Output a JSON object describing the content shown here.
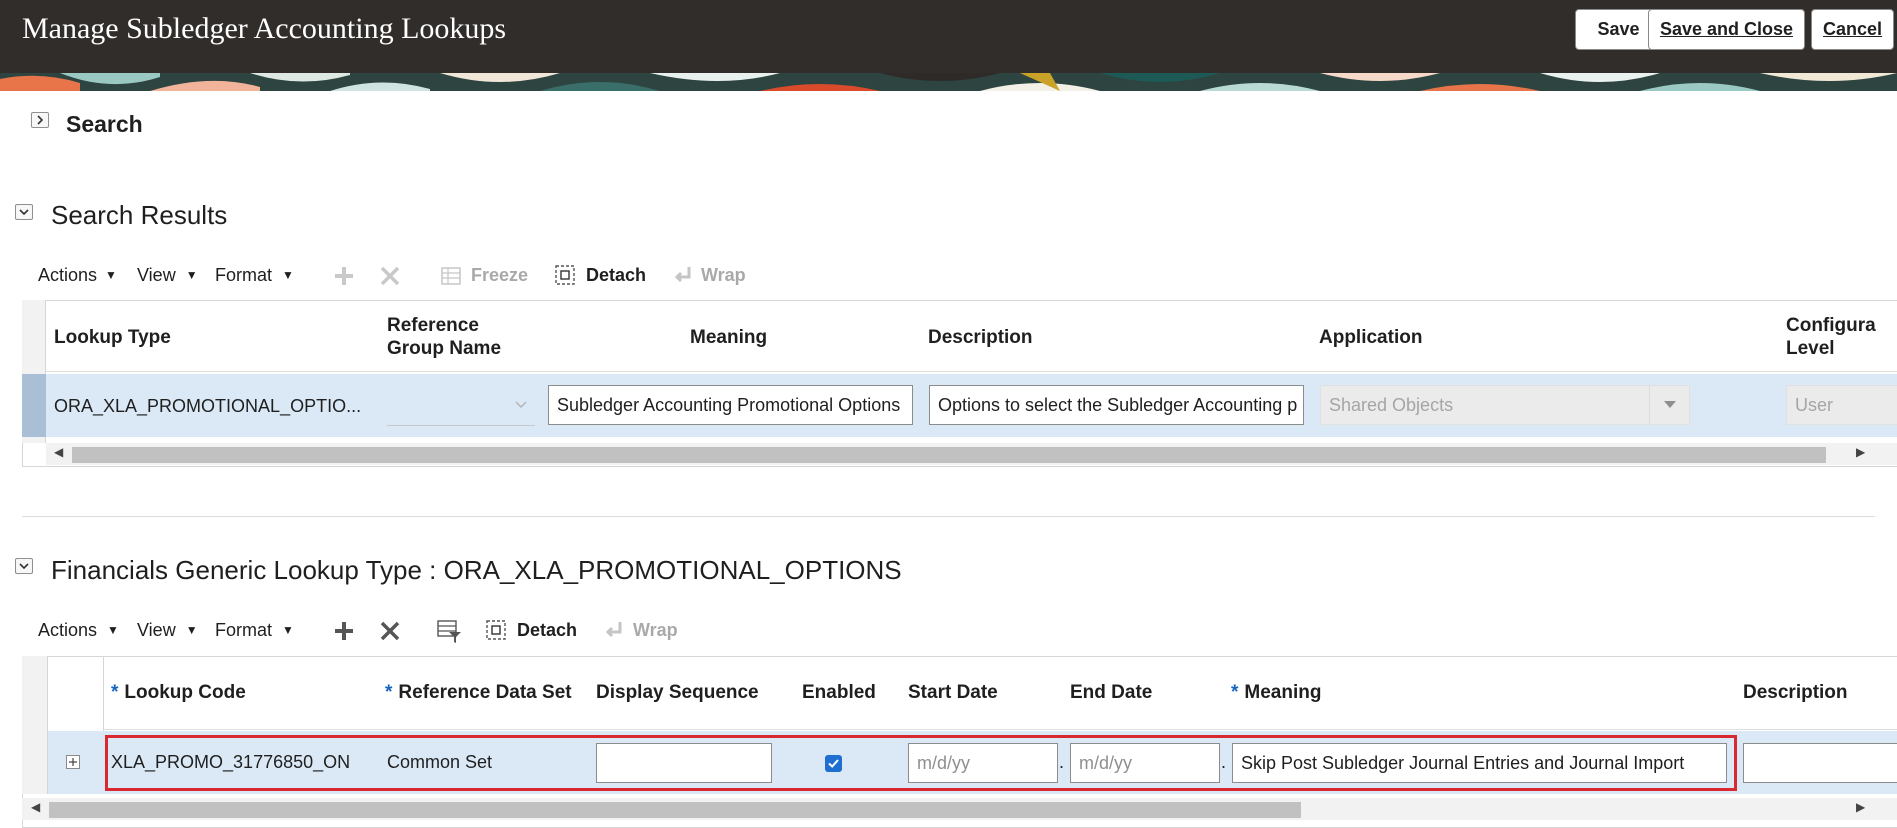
{
  "header": {
    "title": "Manage Subledger Accounting Lookups",
    "save_label": "Save",
    "save_close_label": "Save and Close",
    "cancel_label": "Cancel"
  },
  "search": {
    "title": "Search"
  },
  "results": {
    "title": "Search Results",
    "toolbar": {
      "actions": "Actions",
      "view": "View",
      "format": "Format",
      "freeze": "Freeze",
      "detach": "Detach",
      "wrap": "Wrap"
    },
    "columns": {
      "lookup_type": "Lookup Type",
      "ref_group_line1": "Reference",
      "ref_group_line2": "Group Name",
      "meaning": "Meaning",
      "description": "Description",
      "application": "Application",
      "config_line1": "Configura",
      "config_line2": "Level"
    },
    "row": {
      "lookup_type": "ORA_XLA_PROMOTIONAL_OPTIO...",
      "meaning": "Subledger Accounting Promotional Options",
      "description": "Options to select the Subledger Accounting p",
      "application": "Shared Objects",
      "config_level": "User"
    }
  },
  "detail": {
    "title": "Financials Generic Lookup Type : ORA_XLA_PROMOTIONAL_OPTIONS",
    "toolbar": {
      "actions": "Actions",
      "view": "View",
      "format": "Format",
      "detach": "Detach",
      "wrap": "Wrap"
    },
    "columns": {
      "required_marker": "*",
      "lookup_code": "Lookup Code",
      "reference_data_set": "Reference Data Set",
      "display_sequence": "Display Sequence",
      "enabled": "Enabled",
      "start_date": "Start Date",
      "end_date": "End Date",
      "meaning": "Meaning",
      "description": "Description"
    },
    "row": {
      "expand_icon": "expand-plus-icon",
      "lookup_code": "XLA_PROMO_31776850_ON",
      "reference_data_set": "Common Set",
      "display_sequence": "",
      "enabled": true,
      "start_date_placeholder": "m/d/yy",
      "end_date_placeholder": "m/d/yy",
      "date_separator": ".",
      "meaning": "Skip Post Subledger Journal Entries and Journal Import",
      "description": ""
    },
    "highlight_color": "#d9282f"
  },
  "colors": {
    "header_bg": "#312d2a",
    "selected_row": "#dbe9f6",
    "required": "#1565c0"
  }
}
